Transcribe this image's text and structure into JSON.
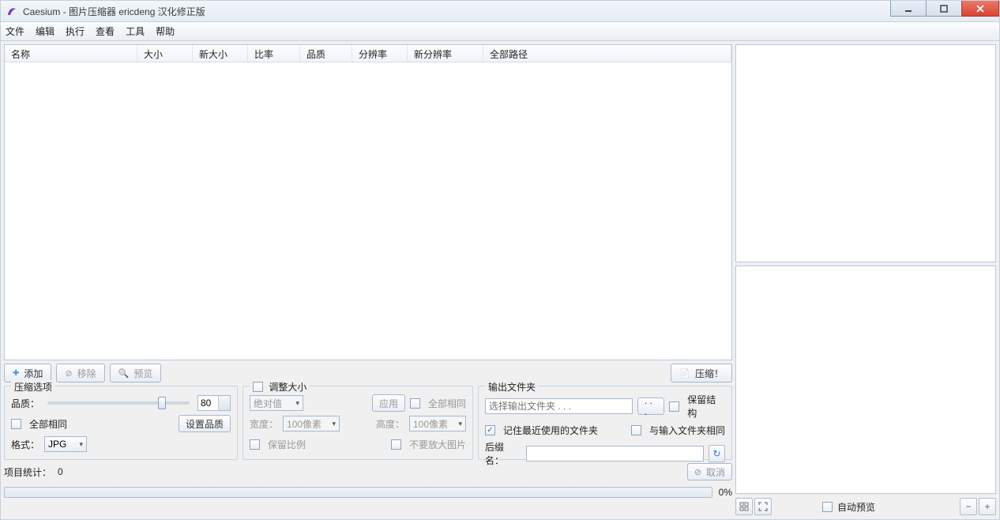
{
  "window": {
    "title": "Caesium - 图片压缩器  ericdeng 汉化修正版"
  },
  "menu": {
    "file": "文件",
    "edit": "编辑",
    "execute": "执行",
    "view": "查看",
    "tools": "工具",
    "help": "帮助"
  },
  "columns": {
    "name": "名称",
    "size": "大小",
    "newsize": "新大小",
    "ratio": "比率",
    "quality": "品质",
    "resolution": "分辨率",
    "newresolution": "新分辨率",
    "fullpath": "全部路径"
  },
  "toolbar": {
    "add": "添加",
    "remove": "移除",
    "preview": "预览",
    "compress": "压缩！"
  },
  "compress_group": {
    "legend": "压缩选项",
    "quality_label": "品质：",
    "quality_value": "80",
    "all_same": "全部相同",
    "set_quality": "设置品质",
    "format_label": "格式：",
    "format_value": "JPG"
  },
  "resize_group": {
    "legend_checkbox_label": "调整大小",
    "mode": "绝对值",
    "apply": "应用",
    "all_same": "全部相同",
    "width_label": "宽度：",
    "width_value": "100像素",
    "height_label": "高度：",
    "height_value": "100像素",
    "keep_ratio": "保留比例",
    "no_enlarge": "不要放大图片"
  },
  "output_group": {
    "legend": "输出文件夹",
    "placeholder": "选择输出文件夹 . . .",
    "browse": ". . .",
    "keep_structure": "保留结构",
    "remember_recent": "记住最近使用的文件夹",
    "same_as_input": "与输入文件夹相同",
    "suffix_label": "后缀名：",
    "suffix_reset_icon": "↻"
  },
  "status": {
    "item_stats_label": "项目统计：",
    "item_count": "0",
    "cancel": "取消",
    "progress_pct": "0%"
  },
  "right": {
    "auto_preview": "自动预览"
  }
}
